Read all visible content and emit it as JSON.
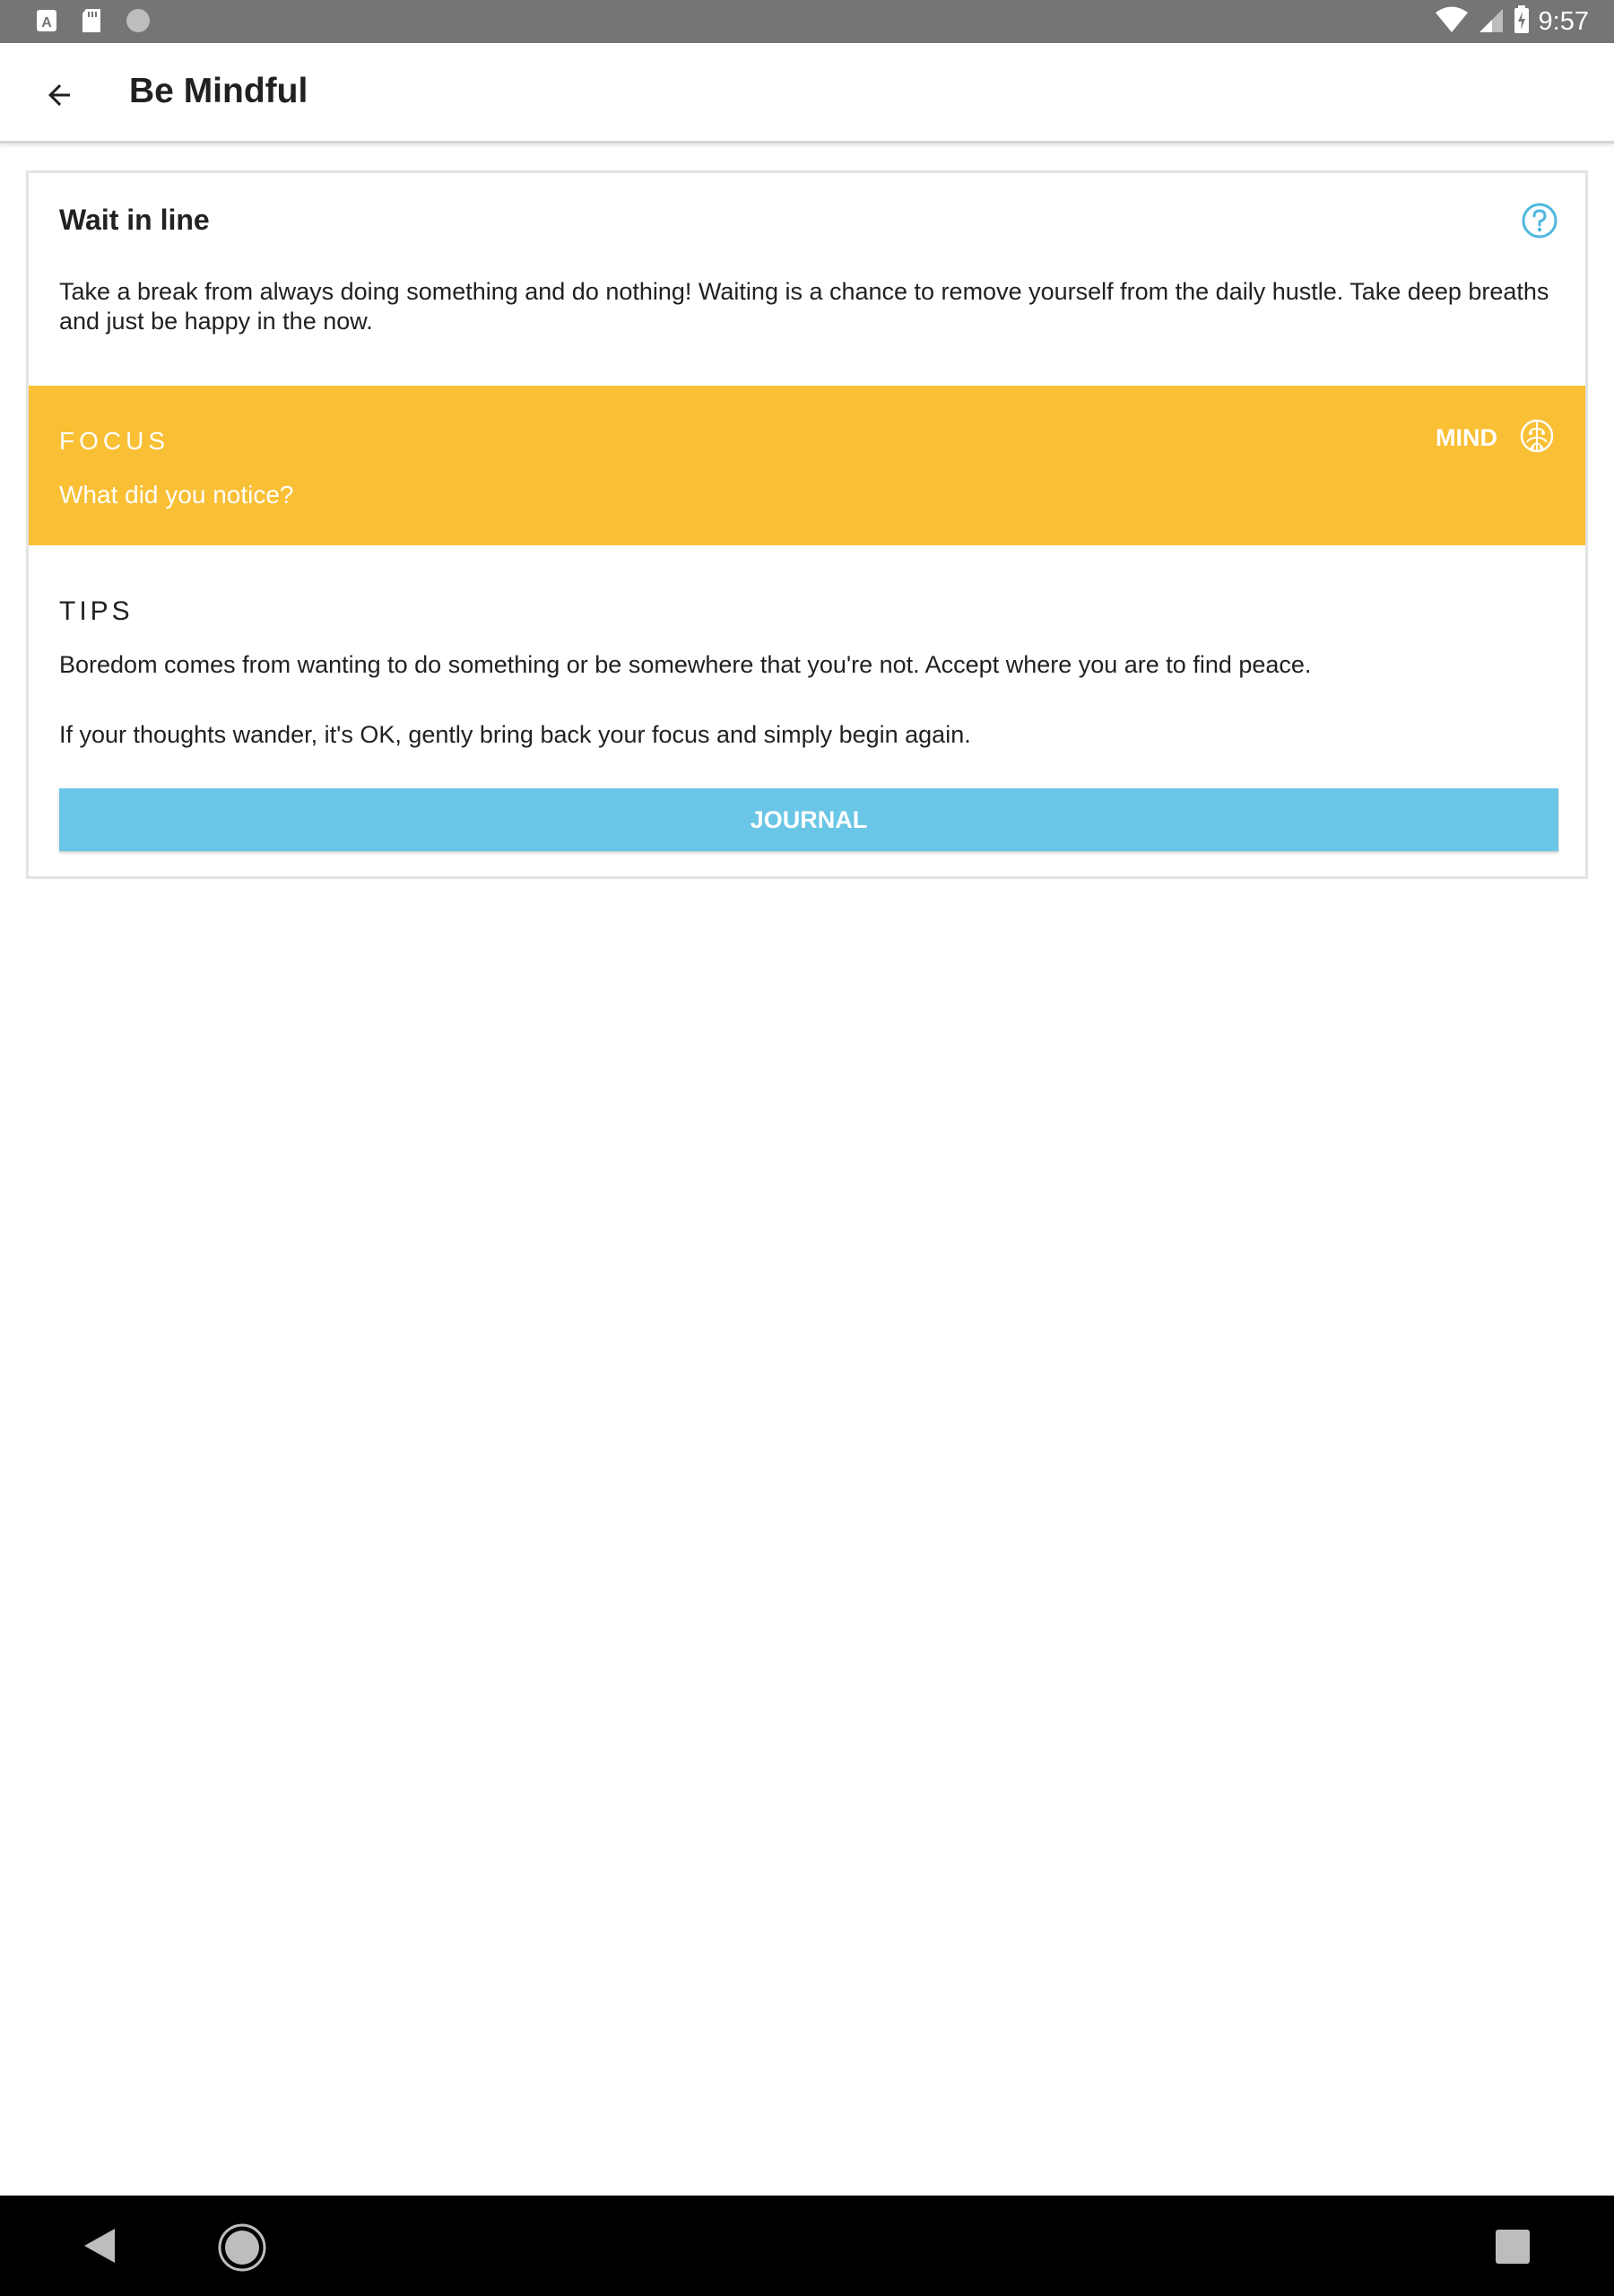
{
  "status_bar": {
    "time": "9:57",
    "icons": [
      "keyboard-a-icon",
      "sd-card-icon",
      "circle-icon",
      "wifi-icon",
      "cell-signal-icon",
      "battery-charging-icon"
    ]
  },
  "app_bar": {
    "title": "Be Mindful",
    "back_icon": "arrow-left-icon"
  },
  "card": {
    "title": "Wait in line",
    "help_icon": "help-circle-icon",
    "description": "Take a break from always doing something and do nothing! Waiting is a chance to remove yourself from the daily hustle. Take deep breaths and just be happy in the now.",
    "focus": {
      "label": "FOCUS",
      "question": "What did you notice?",
      "category": "MIND",
      "category_icon": "brain-icon",
      "color": "#f9bf35"
    },
    "tips": {
      "label": "TIPS",
      "items": [
        "Boredom comes from wanting to do something or be somewhere that you're not. Accept where you are to find peace.",
        "If your thoughts wander, it's OK, gently bring back your focus and simply begin again."
      ]
    },
    "journal_button": {
      "label": "JOURNAL",
      "color": "#69c6e6"
    }
  },
  "nav_bar": {
    "icons": [
      "nav-back-icon",
      "nav-home-icon",
      "nav-recents-icon"
    ]
  }
}
